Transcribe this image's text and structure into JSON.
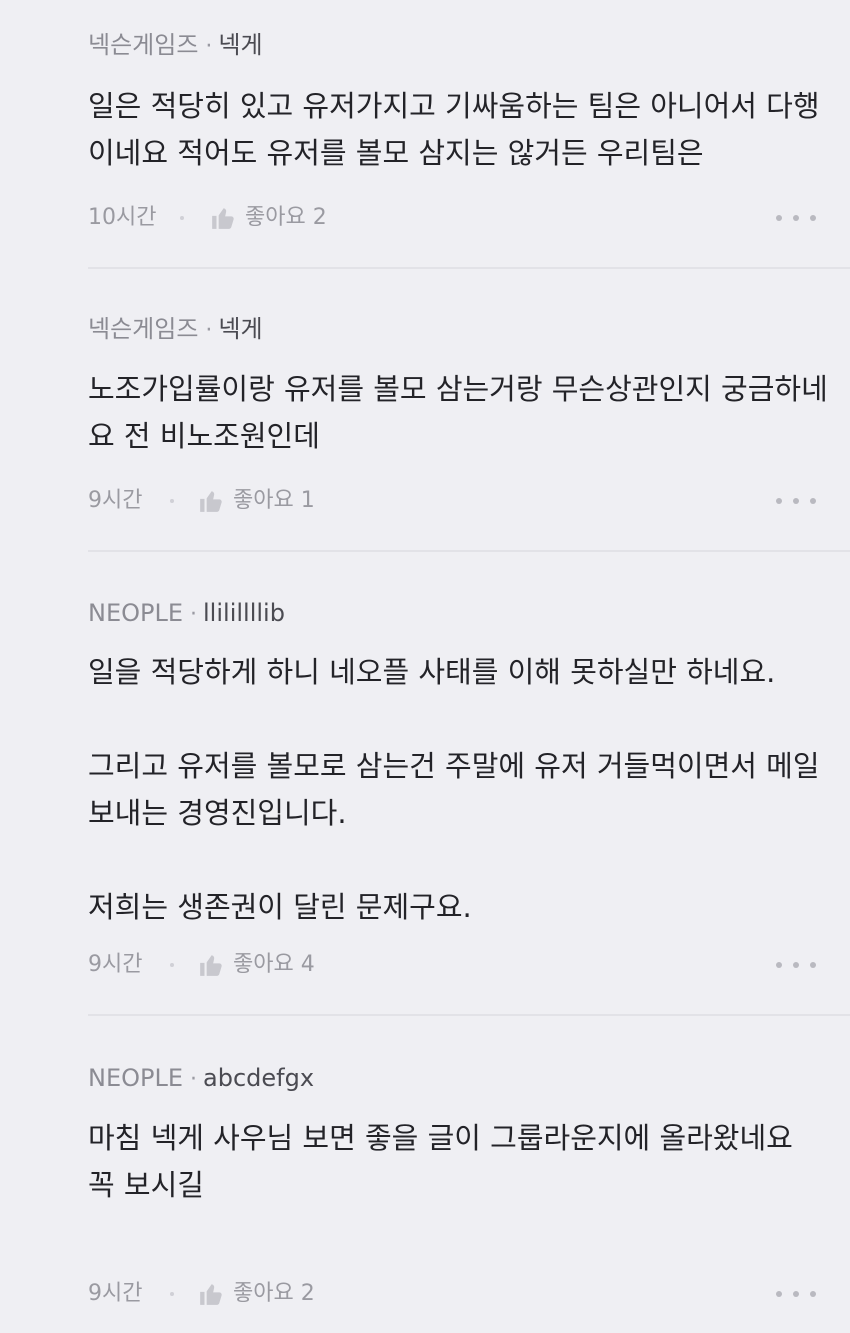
{
  "comments": [
    {
      "company": "넥슨게임즈",
      "author": "넥게",
      "text": "일은 적당히 있고 유저가지고 기싸움하는 팀은 아니어서 다행이네요 적어도 유저를 볼모 삼지는 않거든 우리팀은",
      "time": "10시간",
      "like_label": "좋아요",
      "like_count": "2"
    },
    {
      "company": "넥슨게임즈",
      "author": "넥게",
      "text": "노조가입률이랑 유저를 볼모 삼는거랑 무슨상관인지 궁금하네요 전 비노조원인데",
      "time": "9시간",
      "like_label": "좋아요",
      "like_count": "1"
    },
    {
      "company": "NEOPLE",
      "author": "llilillllib",
      "text": "일을 적당하게 하니 네오플 사태를 이해 못하실만 하네요.\n\n그리고 유저를 볼모로 삼는건 주말에 유저 거들먹이면서 메일 보내는 경영진입니다.\n\n저희는 생존권이 달린 문제구요.",
      "time": "9시간",
      "like_label": "좋아요",
      "like_count": "4"
    },
    {
      "company": "NEOPLE",
      "author": "abcdefgx",
      "text": "마침 넥게 사우님 보면 좋을 글이 그룹라운지에 올라왔네요\n꼭 보시길",
      "time": "9시간",
      "like_label": "좋아요",
      "like_count": "2"
    }
  ],
  "meta_separator": "·",
  "icons": {
    "like": "thumbs-up-icon",
    "more": "more-dots-icon"
  },
  "colors": {
    "background": "#efeff3",
    "text": "#232328",
    "muted": "#9a9aa1",
    "icon": "#c8c8ce"
  }
}
